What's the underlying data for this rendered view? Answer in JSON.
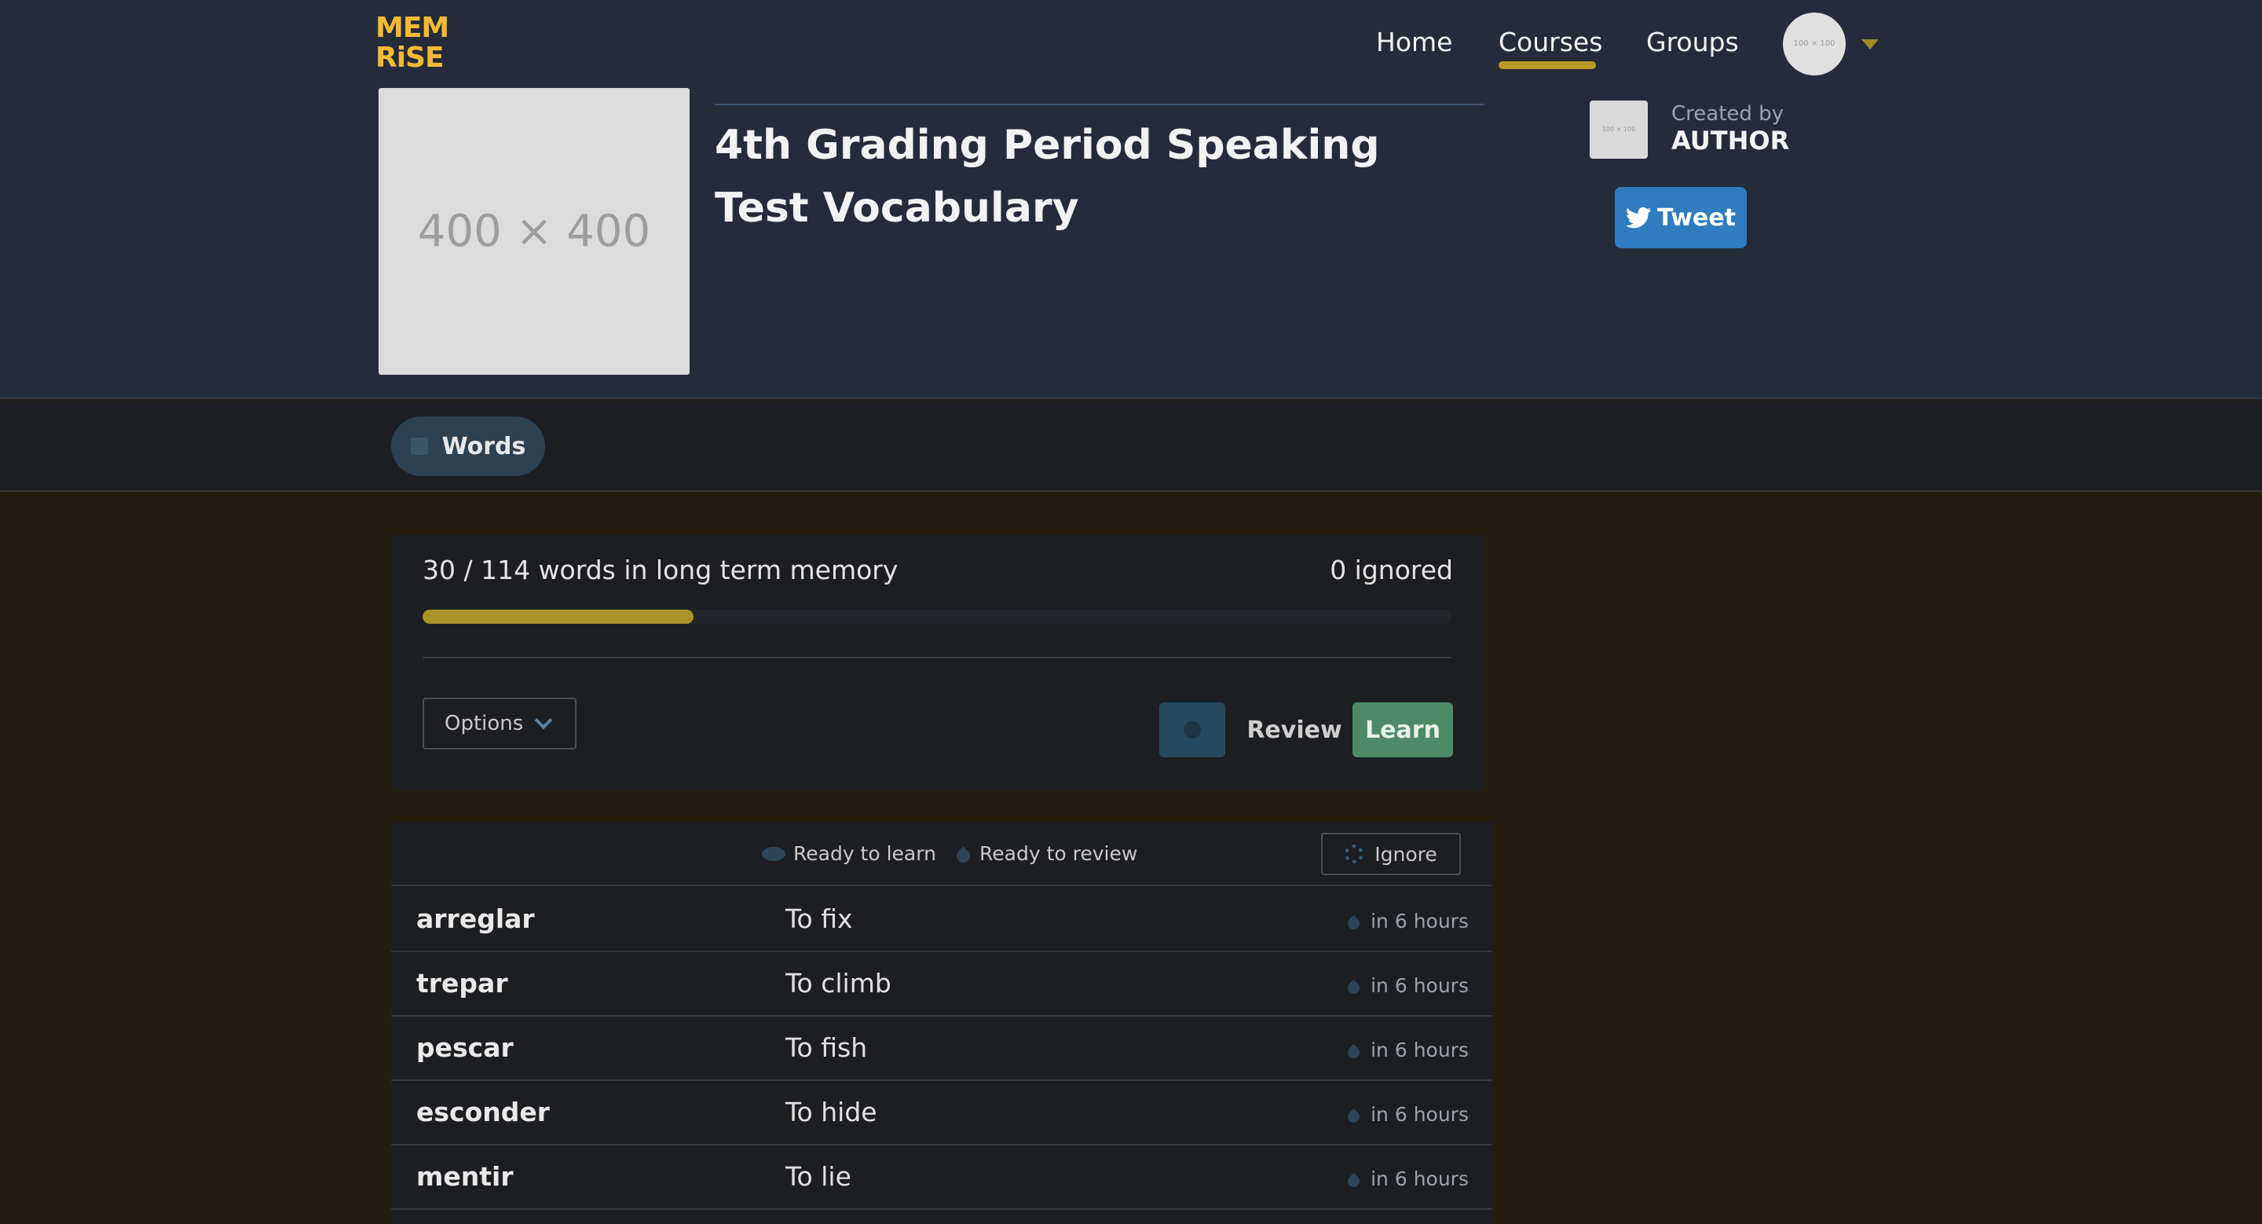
{
  "header": {
    "logo_line1": "MEM",
    "logo_line2": "RiSE",
    "nav": {
      "home": "Home",
      "courses": "Courses",
      "groups": "Groups"
    },
    "avatar_placeholder": "100 × 100",
    "accent_color": "#f4b934"
  },
  "course": {
    "image_placeholder": "400 × 400",
    "title": "4th Grading Period Speaking Test Vocabulary",
    "author_thumb_placeholder": "100 × 100",
    "created_by_label": "Created by",
    "author": "AUTHOR",
    "tweet_label": "Tweet"
  },
  "tabs": {
    "words_label": "Words"
  },
  "progress": {
    "summary": "30 / 114 words in long term memory",
    "ignored": "0 ignored",
    "learned": 30,
    "total": 114,
    "fraction": 0.263,
    "bar_color": "#aa9428",
    "options_label": "Options",
    "review_label": "Review",
    "learn_label": "Learn"
  },
  "word_list": {
    "legend_learn": "Ready to learn",
    "legend_review": "Ready to review",
    "ignore_label": "Ignore",
    "rows": [
      {
        "word": "arreglar",
        "definition": "To fix",
        "status": "in 6 hours"
      },
      {
        "word": "trepar",
        "definition": "To climb",
        "status": "in 6 hours"
      },
      {
        "word": "pescar",
        "definition": "To fish",
        "status": "in 6 hours"
      },
      {
        "word": "esconder",
        "definition": "To hide",
        "status": "in 6 hours"
      },
      {
        "word": "mentir",
        "definition": "To lie",
        "status": "in 6 hours"
      }
    ]
  }
}
